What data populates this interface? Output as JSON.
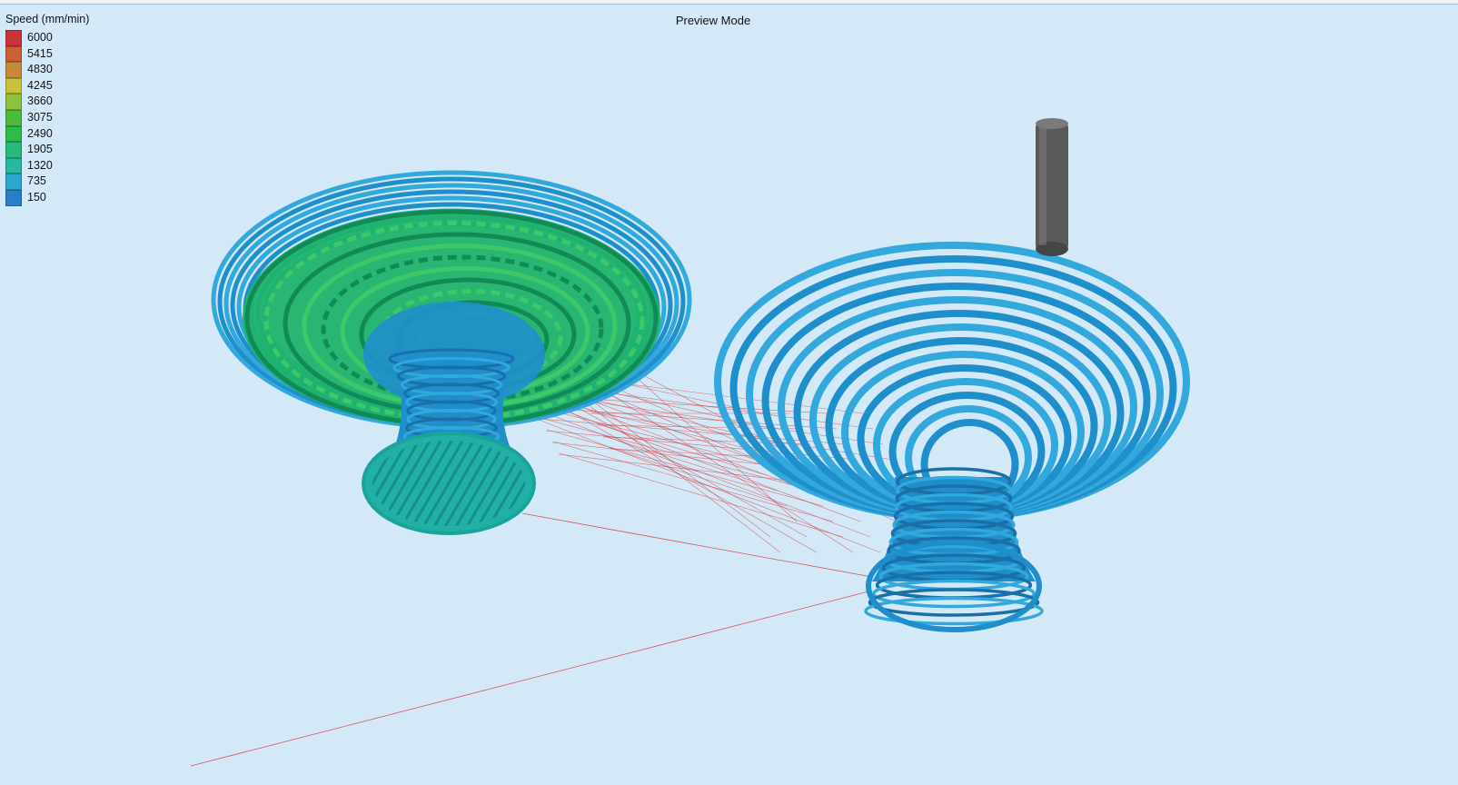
{
  "legend": {
    "title": "Speed (mm/min)",
    "entries": [
      {
        "label": "6000",
        "color": "#c8343a"
      },
      {
        "label": "5415",
        "color": "#c86038"
      },
      {
        "label": "4830",
        "color": "#c88a3a"
      },
      {
        "label": "4245",
        "color": "#c8c23a"
      },
      {
        "label": "3660",
        "color": "#8cc23c"
      },
      {
        "label": "3075",
        "color": "#4cba3c"
      },
      {
        "label": "2490",
        "color": "#2ebc4a"
      },
      {
        "label": "1905",
        "color": "#27ba7a"
      },
      {
        "label": "1320",
        "color": "#27b8a4"
      },
      {
        "label": "735",
        "color": "#2aa8cc"
      },
      {
        "label": "150",
        "color": "#2a7ec8"
      }
    ]
  },
  "mode_label": "Preview Mode",
  "colors": {
    "background": "#d4e9f8",
    "travel_move": "#d23a3a",
    "nozzle": "#5a5a5a"
  }
}
